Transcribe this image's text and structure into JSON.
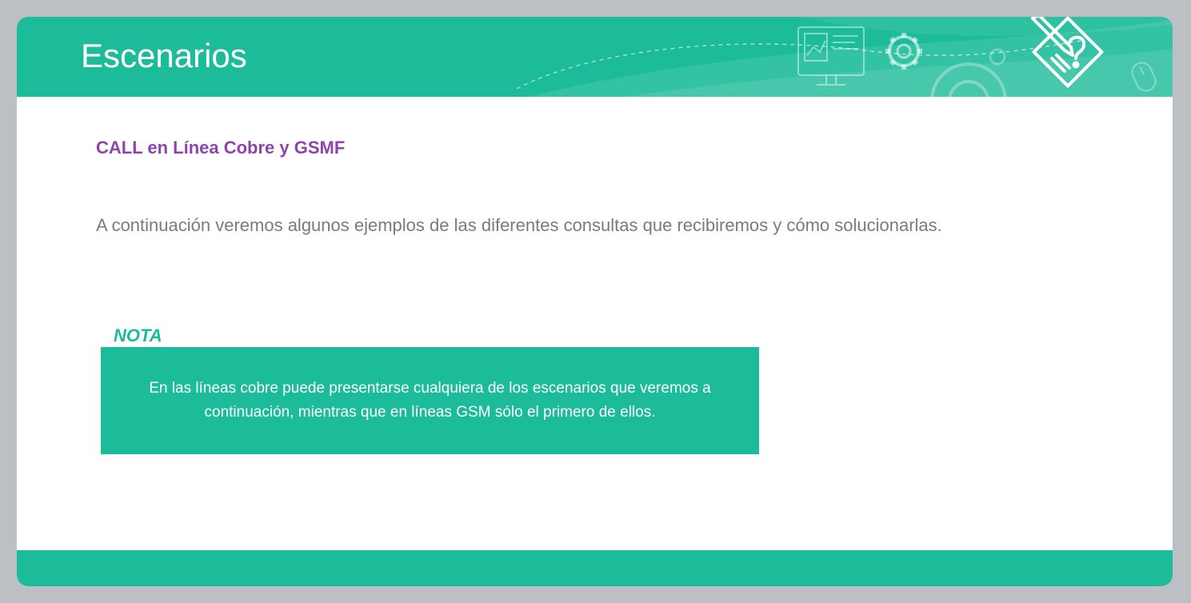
{
  "slide": {
    "title": "Escenarios",
    "subtitle": "CALL en Línea Cobre y GSMF",
    "intro": "A continuación veremos algunos ejemplos de las diferentes consultas que recibiremos y cómo solucionarlas.",
    "note": {
      "label": "NOTA",
      "text": "En las líneas cobre puede presentarse cualquiera de los escenarios que veremos a continuación, mientras que en líneas GSM sólo el primero de ellos."
    }
  },
  "icons": {
    "header_decor": [
      "monitor-chart-icon",
      "gear-icon",
      "large-gear-icon",
      "mouse-icon"
    ],
    "brand": "pencil-question-icon"
  },
  "colors": {
    "teal": "#1cbb99",
    "purple": "#8e44ad",
    "body_text": "#7b7b7b",
    "frame": "#bcc0c4"
  }
}
